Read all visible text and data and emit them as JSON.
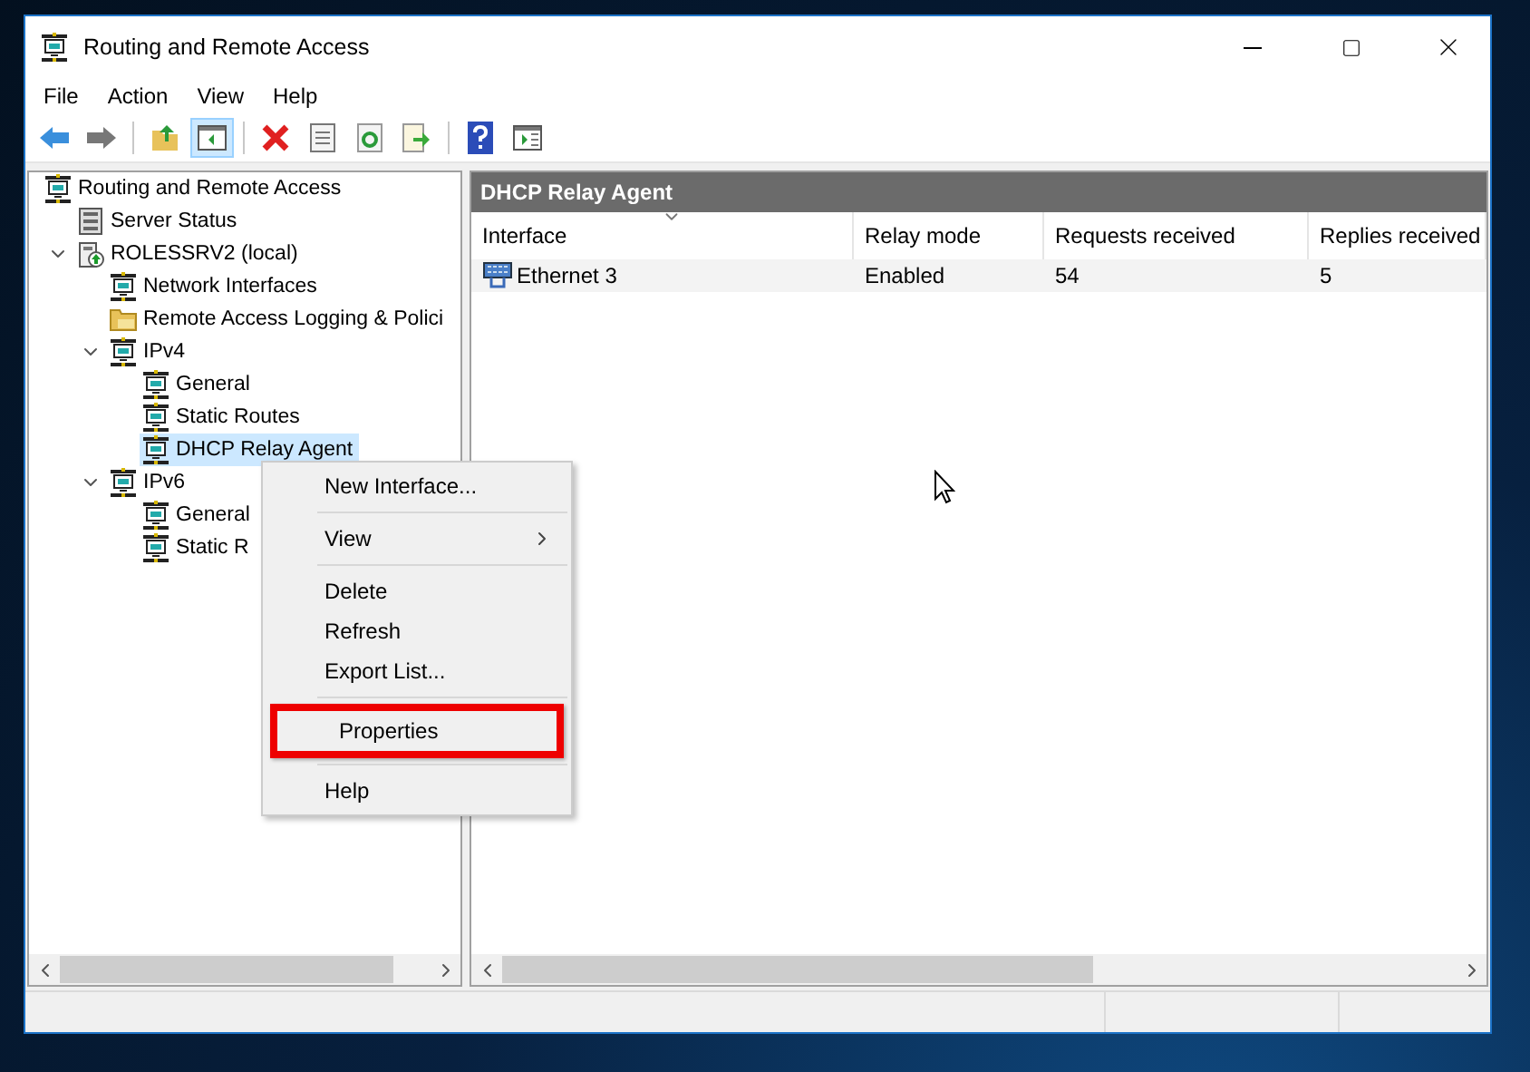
{
  "window": {
    "title": "Routing and Remote Access"
  },
  "menu": [
    "File",
    "Action",
    "View",
    "Help"
  ],
  "toolbar": [
    {
      "kind": "back",
      "pressed": false
    },
    {
      "kind": "forward",
      "pressed": false
    },
    {
      "kind": "separator"
    },
    {
      "kind": "up",
      "pressed": false
    },
    {
      "kind": "tree",
      "pressed": true
    },
    {
      "kind": "separator"
    },
    {
      "kind": "delete",
      "pressed": false
    },
    {
      "kind": "properties",
      "pressed": false
    },
    {
      "kind": "refresh",
      "pressed": false
    },
    {
      "kind": "export",
      "pressed": false
    },
    {
      "kind": "separator"
    },
    {
      "kind": "help",
      "pressed": false
    },
    {
      "kind": "pane",
      "pressed": false
    }
  ],
  "tree": [
    {
      "label": "Routing and Remote Access",
      "kind": "routing",
      "selected": false,
      "children": [
        {
          "label": "Server Status",
          "kind": "server",
          "selected": false
        },
        {
          "label": "ROLESSRV2 (local)",
          "kind": "computer",
          "selected": false,
          "expanded": true,
          "children": [
            {
              "label": "Network Interfaces",
              "kind": "routing",
              "selected": false
            },
            {
              "label": "Remote Access Logging & Polici",
              "kind": "folder",
              "selected": false
            },
            {
              "label": "IPv4",
              "kind": "routing",
              "selected": false,
              "expanded": true,
              "children": [
                {
                  "label": "General",
                  "kind": "routing",
                  "selected": false
                },
                {
                  "label": "Static Routes",
                  "kind": "routing",
                  "selected": false
                },
                {
                  "label": "DHCP Relay Agent",
                  "kind": "routing",
                  "selected": true
                }
              ]
            },
            {
              "label": "IPv6",
              "kind": "routing",
              "selected": false,
              "expanded": true,
              "children": [
                {
                  "label": "General",
                  "kind": "routing",
                  "selected": false
                },
                {
                  "label": "Static R",
                  "kind": "routing",
                  "selected": false
                }
              ]
            }
          ]
        }
      ]
    }
  ],
  "details": {
    "title": "DHCP Relay Agent",
    "columns": [
      {
        "label": "Interface",
        "sorted": true
      },
      {
        "label": "Relay mode",
        "sorted": false
      },
      {
        "label": "Requests received",
        "sorted": false
      },
      {
        "label": "Replies received",
        "sorted": false
      }
    ],
    "rows": [
      {
        "cells": [
          "Ethernet 3",
          "Enabled",
          "54",
          "5"
        ]
      }
    ]
  },
  "context_menu": [
    {
      "kind": "item",
      "label": "New Interface...",
      "highlighted": false
    },
    {
      "kind": "separator"
    },
    {
      "kind": "submenu",
      "label": "View",
      "highlighted": false
    },
    {
      "kind": "separator"
    },
    {
      "kind": "item",
      "label": "Delete",
      "highlighted": false
    },
    {
      "kind": "item",
      "label": "Refresh",
      "highlighted": false
    },
    {
      "kind": "item",
      "label": "Export List...",
      "highlighted": false
    },
    {
      "kind": "separator"
    },
    {
      "kind": "item",
      "label": "Properties",
      "highlighted": true
    },
    {
      "kind": "separator"
    },
    {
      "kind": "item",
      "label": "Help",
      "highlighted": false
    }
  ]
}
